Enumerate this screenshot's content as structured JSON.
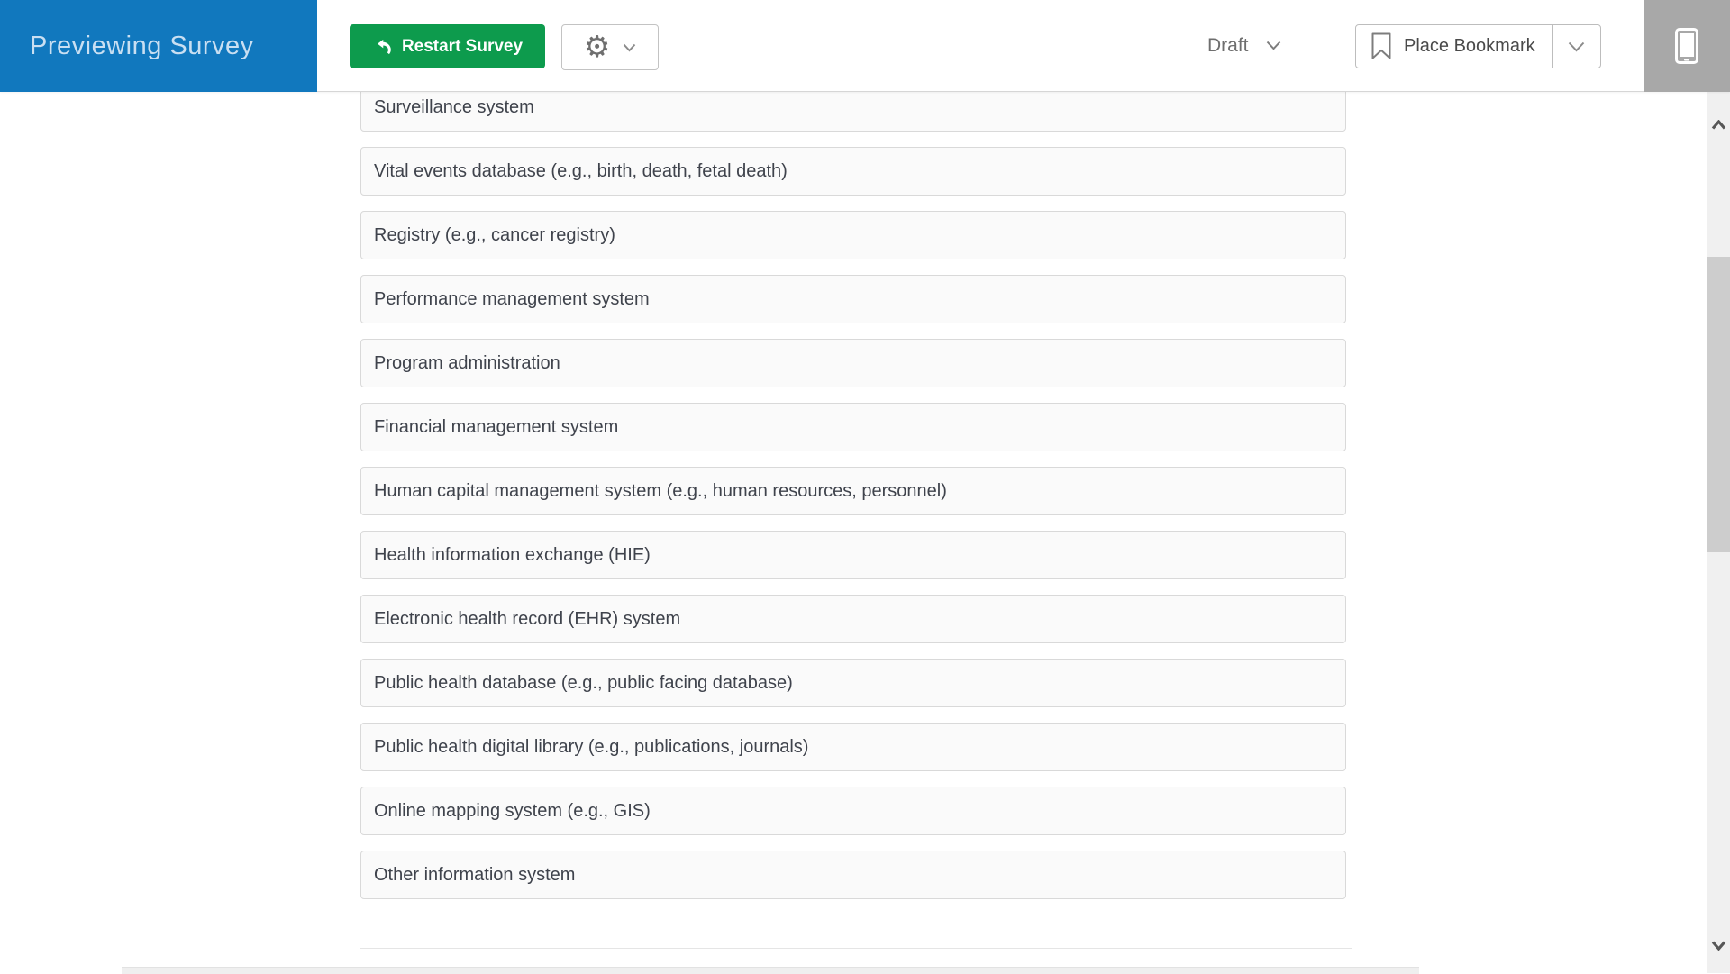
{
  "header": {
    "preview_label": "Previewing Survey",
    "restart_label": "Restart Survey",
    "status_label": "Draft",
    "bookmark_label": "Place Bookmark"
  },
  "survey": {
    "options": [
      "Surveillance system",
      "Vital events database (e.g., birth, death, fetal death)",
      "Registry (e.g., cancer registry)",
      "Performance management system",
      "Program administration",
      "Financial management system",
      "Human capital management system (e.g., human resources, personnel)",
      "Health information exchange (HIE)",
      "Electronic health record (EHR) system",
      "Public health database (e.g., public facing database)",
      "Public health digital library (e.g., publications, journals)",
      "Online mapping system (e.g., GIS)",
      "Other information system"
    ]
  },
  "icons": {
    "restart": "undo-arrow-icon",
    "settings": "gear-icon",
    "settings_caret": "chevron-down-icon",
    "status_caret": "chevron-down-icon",
    "bookmark": "bookmark-icon",
    "bookmark_caret": "chevron-down-icon",
    "device_preview": "tablet-icon",
    "scroll_up": "chevron-up-icon",
    "scroll_down": "chevron-down-icon"
  },
  "colors": {
    "preview_blue": "#1178be",
    "restart_green": "#0d9b4d"
  }
}
